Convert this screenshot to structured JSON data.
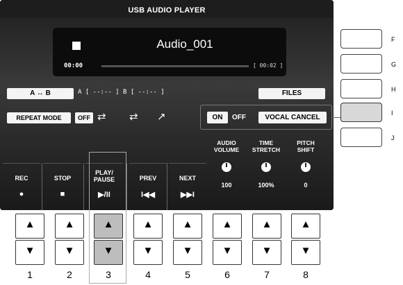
{
  "header": {
    "title": "USB AUDIO PLAYER"
  },
  "now_playing": {
    "song": "Audio_001",
    "time": "00:00",
    "total": "[ 00:02 ]"
  },
  "ab": {
    "button": "A ↔ B",
    "values": "A [ --:-- ]  B [ --:-- ]"
  },
  "files_button": "FILES",
  "repeat": {
    "label": "REPEAT MODE",
    "off": "OFF",
    "icons": [
      "⇄",
      "⇄",
      "↗"
    ]
  },
  "vocal": {
    "on": "ON",
    "off": "OFF",
    "cancel": "VOCAL CANCEL"
  },
  "knobs": [
    {
      "label": "AUDIO\nVOLUME",
      "value": "100"
    },
    {
      "label": "TIME\nSTRETCH",
      "value": "100%"
    },
    {
      "label": "PITCH\nSHIFT",
      "value": "0"
    }
  ],
  "transport": [
    {
      "label": "REC",
      "symbol": "●"
    },
    {
      "label": "STOP",
      "symbol": "■"
    },
    {
      "label": "PLAY/\nPAUSE",
      "symbol": "▶/II"
    },
    {
      "label": "PREV",
      "symbol": "I◀◀"
    },
    {
      "label": "NEXT",
      "symbol": "▶▶I"
    }
  ],
  "side_buttons": [
    "F",
    "G",
    "H",
    "I",
    "J"
  ],
  "physical": [
    "1",
    "2",
    "3",
    "4",
    "5",
    "6",
    "7",
    "8"
  ],
  "arrows": {
    "up": "▲",
    "down": "▼"
  }
}
